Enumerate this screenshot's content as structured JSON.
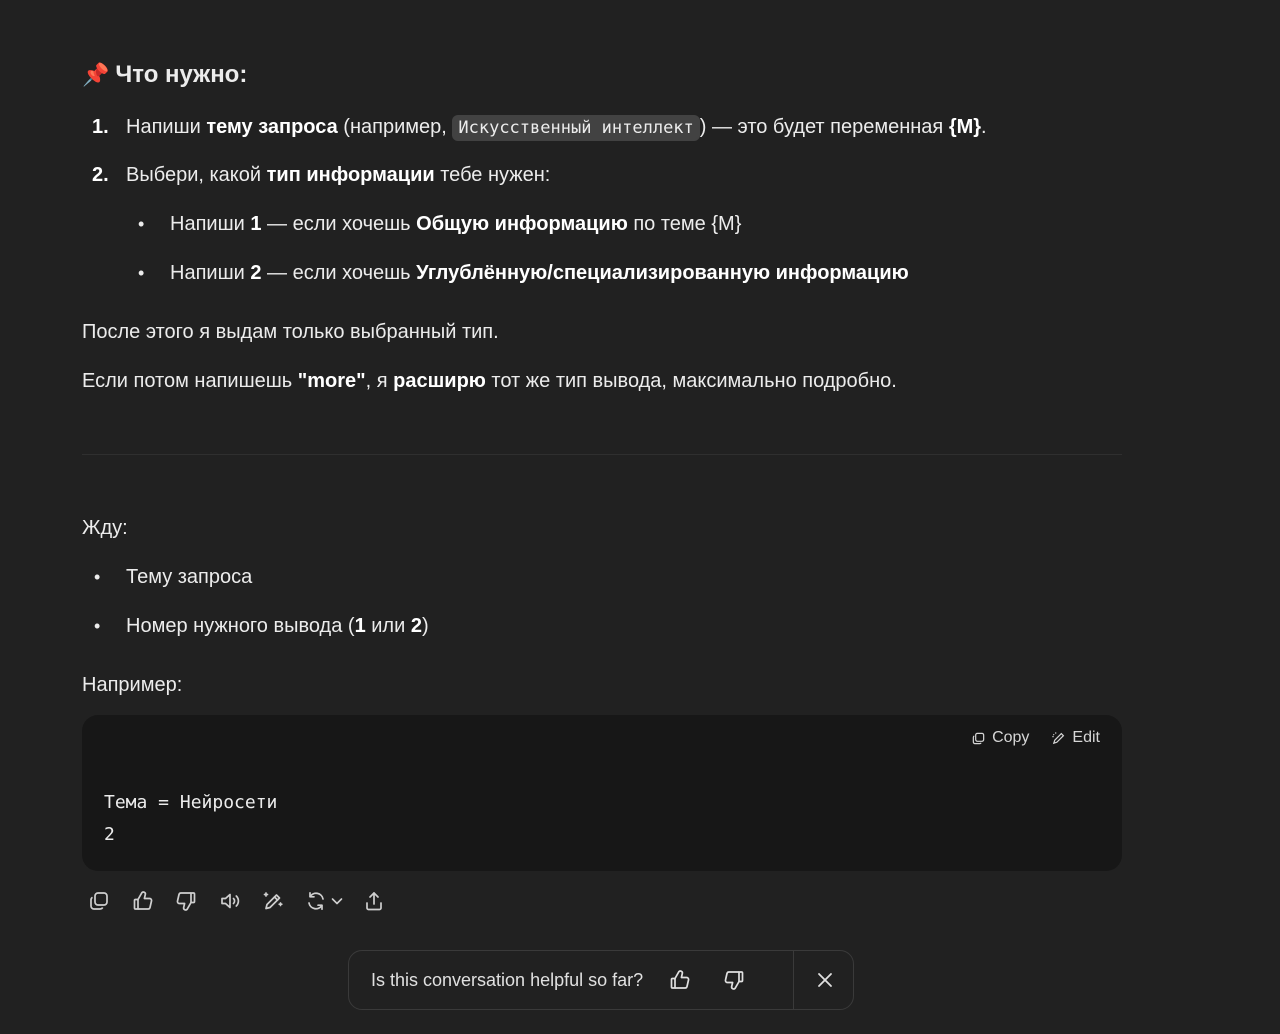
{
  "heading": {
    "emoji": "📌",
    "text": "Что нужно:"
  },
  "steps": [
    {
      "number": "1.",
      "p1": "Напиши ",
      "b1": "тему запроса",
      "p2": " (например, ",
      "code": "Искусственный интеллект",
      "p3": ") — это будет переменная ",
      "b2": "{M}",
      "p4": "."
    },
    {
      "number": "2.",
      "p1": "Выбери, какой ",
      "b1": "тип информации",
      "p2": " тебе нужен:"
    }
  ],
  "options": [
    {
      "p1": "Напиши ",
      "b1": "1",
      "p2": " — если хочешь ",
      "b2": "Общую информацию",
      "p3": " по теме {M}"
    },
    {
      "p1": "Напиши ",
      "b1": "2",
      "p2": " — если хочешь ",
      "b2": "Углублённую/специализированную информацию",
      "p3": ""
    }
  ],
  "after_text": "После этого я выдам только выбранный тип.",
  "more_line": {
    "p1": "Если потом напишешь ",
    "b1": "\"more\"",
    "p2": ", я ",
    "b2": "расширю",
    "p3": " тот же тип вывода, максимально подробно."
  },
  "waiting_label": "Жду:",
  "waiting_items": [
    {
      "p1": "Тему запроса",
      "b1": "",
      "p2": "",
      "b2": "",
      "p3": ""
    },
    {
      "p1": "Номер нужного вывода (",
      "b1": "1",
      "p2": " или ",
      "b2": "2",
      "p3": ")"
    }
  ],
  "example_label": "Например:",
  "code_block": {
    "copy_label": "Copy",
    "edit_label": "Edit",
    "line1": "Тема = Нейросети",
    "line2": "2"
  },
  "toolbar_icons": [
    "copy-icon",
    "thumbs-up-icon",
    "thumbs-down-icon",
    "speaker-icon",
    "edit-sparkle-icon",
    "regenerate-icon",
    "share-icon"
  ],
  "feedback": {
    "question": "Is this conversation helpful so far?"
  },
  "colors": {
    "background": "#212121",
    "code_block": "#171717",
    "inline_code": "#424242",
    "text": "#ececec"
  }
}
